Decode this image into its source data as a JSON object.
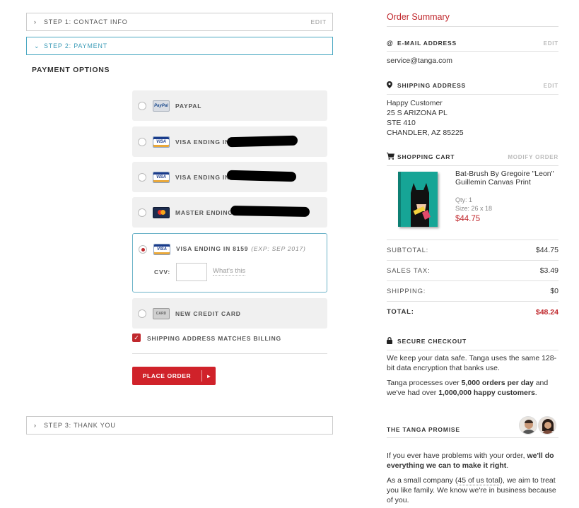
{
  "steps": {
    "step1": {
      "label": "STEP 1: CONTACT INFO",
      "edit": "EDIT"
    },
    "step2": {
      "label": "STEP 2: PAYMENT"
    },
    "step3": {
      "label": "STEP 3: THANK YOU"
    }
  },
  "payment": {
    "title": "PAYMENT OPTIONS",
    "options": [
      {
        "label": "PAYPAL",
        "card": "paypal",
        "card_text": "PayPal"
      },
      {
        "label": "VISA ENDING IN",
        "card": "visa",
        "card_text": "VISA",
        "redacted": true
      },
      {
        "label": "VISA ENDING IN",
        "card": "visa",
        "card_text": "VISA",
        "redacted": true
      },
      {
        "label": "MASTER ENDING",
        "card": "mastercard",
        "redacted": true
      },
      {
        "label": "VISA ENDING IN 8159",
        "exp": "(EXP: SEP 2017)",
        "card": "visa",
        "card_text": "VISA",
        "selected": true
      },
      {
        "label": "NEW CREDIT CARD",
        "card": "generic",
        "card_text": "CARD"
      }
    ],
    "cvv_label": "CVV:",
    "cvv_value": "",
    "cvv_help": "What's this",
    "shipping_match": "SHIPPING ADDRESS MATCHES BILLING",
    "shipping_match_checked": true,
    "place_order": "PLACE ORDER",
    "place_order_arrow": "▸"
  },
  "summary": {
    "title": "Order Summary",
    "email": {
      "heading": "E-MAIL ADDRESS",
      "edit": "EDIT",
      "value": "service@tanga.com"
    },
    "shipping": {
      "heading": "SHIPPING ADDRESS",
      "edit": "EDIT",
      "lines": [
        "Happy Customer",
        "25 S ARIZONA PL",
        "STE 410",
        "CHANDLER, AZ 85225"
      ]
    },
    "cart": {
      "heading": "SHOPPING CART",
      "modify": "MODIFY ORDER",
      "item": {
        "name_line1": "Bat-Brush By Gregoire \"Leon\"",
        "name_line2": "Guillemin Canvas Print",
        "qty": "Qty: 1",
        "size": "Size: 26 x 18",
        "price": "$44.75"
      }
    },
    "totals": [
      {
        "label": "SUBTOTAL:",
        "value": "$44.75"
      },
      {
        "label": "SALES TAX:",
        "value": "$3.49"
      },
      {
        "label": "SHIPPING:",
        "value": "$0"
      },
      {
        "label": "TOTAL:",
        "value": "$48.24"
      }
    ],
    "secure": {
      "heading": "SECURE CHECKOUT",
      "p1": "We keep your data safe. Tanga uses the same 128-bit data encryption that banks use.",
      "p2_a": "Tanga processes over ",
      "p2_b": "5,000 orders per day",
      "p2_c": " and we've had over ",
      "p2_d": "1,000,000 happy customers",
      "p2_e": "."
    },
    "promise": {
      "heading": "THE TANGA PROMISE",
      "p1_a": "If you ever have problems with your order, ",
      "p1_b": "we'll do everything we can to make it right",
      "p1_c": ".",
      "p2_a": "As a small company (",
      "p2_link": "45 of us total",
      "p2_b": "), we aim to treat you like family. We know we're in business because of you."
    }
  },
  "colors": {
    "accent_red": "#c0282d",
    "active_blue": "#4aa8c2",
    "button_red": "#d0222a"
  }
}
